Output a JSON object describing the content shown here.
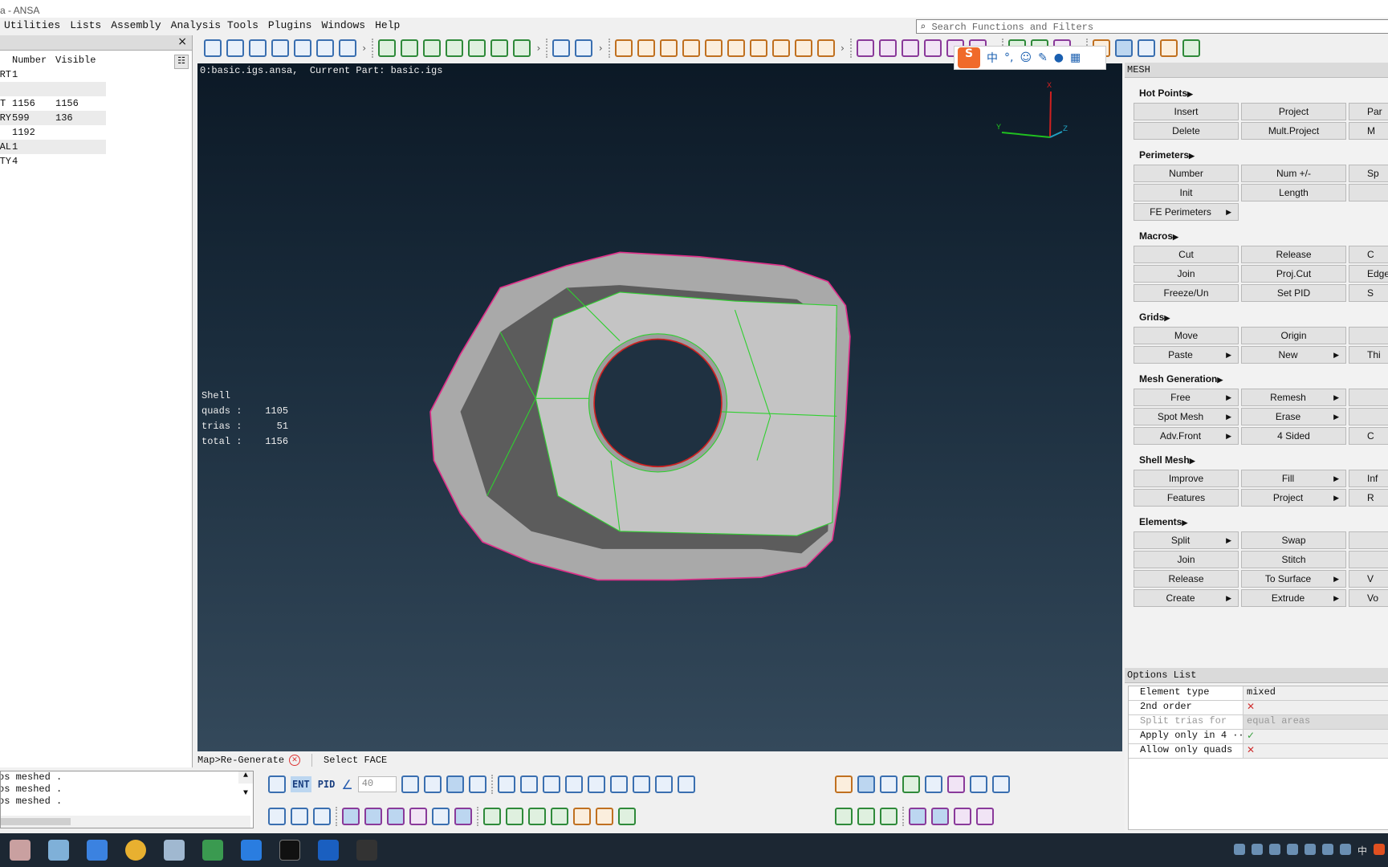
{
  "window": {
    "title": "a - ANSA"
  },
  "menu": [
    "Utilities",
    "Lists",
    "Assembly",
    "Analysis Tools",
    "Plugins",
    "Windows",
    "Help"
  ],
  "search": {
    "placeholder": "Search Functions and Filters",
    "icon": "search-icon"
  },
  "left_panel": {
    "close": "×",
    "columns": [
      "",
      "Number",
      "Visible"
    ],
    "rows": [
      [
        "RT",
        "1",
        ""
      ],
      [
        "",
        "",
        ""
      ],
      [
        "T",
        "1156",
        "1156"
      ],
      [
        "RY",
        "599",
        "136"
      ],
      [
        "",
        "1192",
        ""
      ],
      [
        "AL",
        "1",
        ""
      ],
      [
        "TY",
        "4",
        ""
      ]
    ]
  },
  "viewport": {
    "title": "0:basic.igs.ansa,  Current Part: basic.igs",
    "stats": {
      "heading": "Shell",
      "quads": "quads :    1105",
      "trias": "trias :      51",
      "total": "total :    1156"
    },
    "axes": {
      "x": "X",
      "y": "Y",
      "z": "Z"
    },
    "colors": {
      "mesh": "#9a9a9a",
      "feature_lines": "#30d030",
      "free_edges": "#e0308a",
      "hole_edge": "#d02020"
    }
  },
  "ime": {
    "logo": "S",
    "lang": "中",
    "punct": "°,"
  },
  "right_panel": {
    "title": "MESH",
    "sections": [
      {
        "title": "Hot Points",
        "rows": [
          [
            {
              "l": "Insert"
            },
            {
              "l": "Project"
            },
            {
              "l": "Par"
            }
          ],
          [
            {
              "l": "Delete"
            },
            {
              "l": "Mult.Project"
            },
            {
              "l": "M"
            }
          ]
        ]
      },
      {
        "title": "Perimeters",
        "rows": [
          [
            {
              "l": "Number"
            },
            {
              "l": "Num +/-"
            },
            {
              "l": "Sp"
            }
          ],
          [
            {
              "l": "Init"
            },
            {
              "l": "Length"
            },
            {
              "l": ""
            }
          ],
          [
            {
              "l": "FE Perimeters",
              "a": true
            }
          ]
        ]
      },
      {
        "title": "Macros",
        "rows": [
          [
            {
              "l": "Cut"
            },
            {
              "l": "Release"
            },
            {
              "l": "C"
            }
          ],
          [
            {
              "l": "Join"
            },
            {
              "l": "Proj.Cut"
            },
            {
              "l": "Edge"
            }
          ],
          [
            {
              "l": "Freeze/Un"
            },
            {
              "l": "Set PID"
            },
            {
              "l": "S"
            }
          ]
        ]
      },
      {
        "title": "Grids",
        "rows": [
          [
            {
              "l": "Move"
            },
            {
              "l": "Origin"
            },
            {
              "l": ""
            }
          ],
          [
            {
              "l": "Paste",
              "a": true
            },
            {
              "l": "New",
              "a": true
            },
            {
              "l": "Thi"
            }
          ]
        ]
      },
      {
        "title": "Mesh Generation",
        "rows": [
          [
            {
              "l": "Free",
              "a": true
            },
            {
              "l": "Remesh",
              "a": true
            },
            {
              "l": ""
            }
          ],
          [
            {
              "l": "Spot Mesh",
              "a": true
            },
            {
              "l": "Erase",
              "a": true
            },
            {
              "l": ""
            }
          ],
          [
            {
              "l": "Adv.Front",
              "a": true
            },
            {
              "l": "4 Sided"
            },
            {
              "l": "C"
            }
          ]
        ]
      },
      {
        "title": "Shell Mesh",
        "rows": [
          [
            {
              "l": "Improve"
            },
            {
              "l": "Fill",
              "a": true
            },
            {
              "l": "Inf"
            }
          ],
          [
            {
              "l": "Features"
            },
            {
              "l": "Project",
              "a": true
            },
            {
              "l": "R"
            }
          ]
        ]
      },
      {
        "title": "Elements",
        "rows": [
          [
            {
              "l": "Split",
              "a": true
            },
            {
              "l": "Swap"
            },
            {
              "l": ""
            }
          ],
          [
            {
              "l": "Join"
            },
            {
              "l": "Stitch"
            },
            {
              "l": ""
            }
          ],
          [
            {
              "l": "Release"
            },
            {
              "l": "To Surface",
              "a": true
            },
            {
              "l": "V"
            }
          ],
          [
            {
              "l": "Create",
              "a": true
            },
            {
              "l": "Extrude",
              "a": true
            },
            {
              "l": "Vo"
            }
          ]
        ]
      }
    ]
  },
  "options_list": {
    "title": "Options List",
    "rows": [
      {
        "label": "Element type",
        "value": "mixed",
        "kind": "text"
      },
      {
        "label": "2nd order",
        "value": "✕",
        "kind": "cross"
      },
      {
        "label": "Split trias for",
        "value": "equal areas",
        "kind": "disabled"
      },
      {
        "label": "Apply only in 4 ···",
        "value": "✓",
        "kind": "check"
      },
      {
        "label": "Allow only quads",
        "value": "✕",
        "kind": "cross"
      }
    ]
  },
  "status": {
    "path": "Map>Re-Generate",
    "cancel": "✕",
    "prompt": "Select FACE"
  },
  "log": [
    "os meshed .",
    "os meshed .",
    "os meshed ."
  ],
  "bottom_toolbar": {
    "ent": "ENT",
    "pid": "PID",
    "angle": "40"
  },
  "tray": {
    "lang": "中"
  }
}
